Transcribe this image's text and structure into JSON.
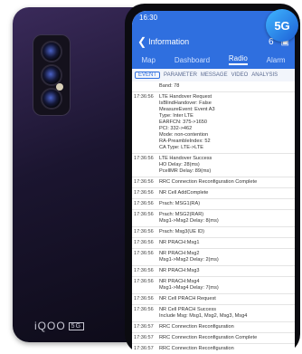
{
  "app": {
    "status_time": "16:30",
    "title": "Information",
    "back_glyph": "❮",
    "icon_pin": "6",
    "icon_save": "▣",
    "main_tabs": [
      "Map",
      "Dashboard",
      "Radio",
      "Alarm"
    ],
    "active_main_tab": "Radio",
    "sub_tabs": [
      "EVENT",
      "PARAMETER",
      "MESSAGE",
      "VIDEO",
      "ANALYSIS"
    ],
    "active_sub_tab": "EVENT",
    "badge": "5G"
  },
  "phone": {
    "brand": "iQOO",
    "brand_badge": "5G"
  },
  "log": [
    {
      "time": "",
      "msg": "Band: 78"
    },
    {
      "time": "17:36:56",
      "msg": "LTE Handover Request\nIsBlindHandover: False\nMeasureEvent: Event A3\nType: Inter LTE\nEARFCN: 375->1650\nPCI: 332->462\nMode: non-contention\nRA-PreambleIndex: 52\nCA Type: LTE->LTE"
    },
    {
      "time": "17:36:56",
      "msg": "LTE Handover Success\nHO Delay: 28(ms)\nPcellMR Delay: 89(ms)"
    },
    {
      "time": "17:36:56",
      "msg": "RRC Connection Reconfiguration Complete"
    },
    {
      "time": "17:36:56",
      "msg": "NR Cell AddComplete"
    },
    {
      "time": "17:36:56",
      "msg": "Prach: MSG1(RA)"
    },
    {
      "time": "17:36:56",
      "msg": "Prach: MSG2(RAR)\nMsg1->Msg2 Delay: 8(ms)"
    },
    {
      "time": "17:36:56",
      "msg": "Prach: Msg3(UE ID)"
    },
    {
      "time": "17:36:56",
      "msg": "NR PRACH:Msg1"
    },
    {
      "time": "17:36:56",
      "msg": "NR PRACH:Msg2\nMsg1->Msg2 Delay: 2(ms)"
    },
    {
      "time": "17:36:56",
      "msg": "NR PRACH:Msg3"
    },
    {
      "time": "17:36:56",
      "msg": "NR PRACH:Msg4\nMsg1->Msg4 Delay: 7(ms)"
    },
    {
      "time": "17:36:56",
      "msg": "NR Cell PRACH Request"
    },
    {
      "time": "17:36:56",
      "msg": "NR Cell PRACH Success\nInclude Msg: Msg1, Msg2, Msg3, Msg4"
    },
    {
      "time": "17:36:57",
      "msg": "RRC Connection Reconfiguration"
    },
    {
      "time": "17:36:57",
      "msg": "RRC Connection Reconfiguration Complete"
    },
    {
      "time": "17:36:57",
      "msg": "RRC Connection Reconfiguration"
    },
    {
      "time": "17:36:57",
      "msg": "RRC Connection Reconfiguration Complete"
    }
  ]
}
